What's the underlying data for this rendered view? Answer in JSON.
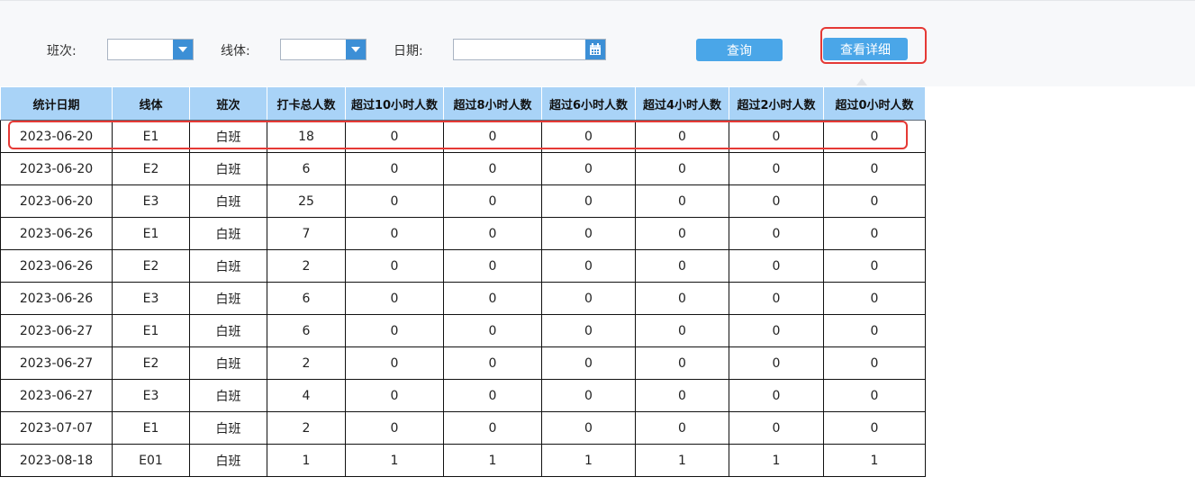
{
  "filters": {
    "shift_label": "班次:",
    "line_label": "线体:",
    "date_label": "日期:",
    "shift_value": "",
    "line_value": "",
    "date_value": ""
  },
  "buttons": {
    "query": "查询",
    "view_details": "查看详细"
  },
  "table": {
    "headers": [
      "统计日期",
      "线体",
      "班次",
      "打卡总人数",
      "超过10小时人数",
      "超过8小时人数",
      "超过6小时人数",
      "超过4小时人数",
      "超过2小时人数",
      "超过0小时人数"
    ],
    "rows": [
      [
        "2023-06-20",
        "E1",
        "白班",
        "18",
        "0",
        "0",
        "0",
        "0",
        "0",
        "0"
      ],
      [
        "2023-06-20",
        "E2",
        "白班",
        "6",
        "0",
        "0",
        "0",
        "0",
        "0",
        "0"
      ],
      [
        "2023-06-20",
        "E3",
        "白班",
        "25",
        "0",
        "0",
        "0",
        "0",
        "0",
        "0"
      ],
      [
        "2023-06-26",
        "E1",
        "白班",
        "7",
        "0",
        "0",
        "0",
        "0",
        "0",
        "0"
      ],
      [
        "2023-06-26",
        "E2",
        "白班",
        "2",
        "0",
        "0",
        "0",
        "0",
        "0",
        "0"
      ],
      [
        "2023-06-26",
        "E3",
        "白班",
        "6",
        "0",
        "0",
        "0",
        "0",
        "0",
        "0"
      ],
      [
        "2023-06-27",
        "E1",
        "白班",
        "6",
        "0",
        "0",
        "0",
        "0",
        "0",
        "0"
      ],
      [
        "2023-06-27",
        "E2",
        "白班",
        "2",
        "0",
        "0",
        "0",
        "0",
        "0",
        "0"
      ],
      [
        "2023-06-27",
        "E3",
        "白班",
        "4",
        "0",
        "0",
        "0",
        "0",
        "0",
        "0"
      ],
      [
        "2023-07-07",
        "E1",
        "白班",
        "2",
        "0",
        "0",
        "0",
        "0",
        "0",
        "0"
      ],
      [
        "2023-08-18",
        "E01",
        "白班",
        "1",
        "1",
        "1",
        "1",
        "1",
        "1",
        "1"
      ]
    ]
  },
  "colors": {
    "header_bg": "#a9d3f7",
    "button_bg": "#4aa6e8",
    "dropdown_accent": "#3c8fd6",
    "highlight": "#e53935"
  },
  "icons": {
    "dropdown": "chevron-down-icon",
    "calendar": "calendar-icon"
  }
}
